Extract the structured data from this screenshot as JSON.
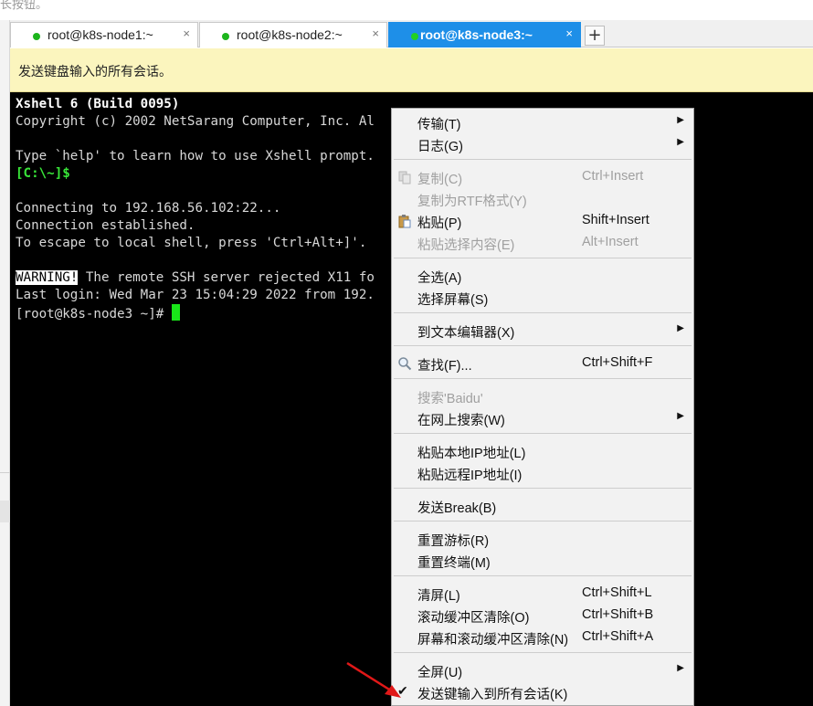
{
  "top_fragment": "长按钮。",
  "tabs": [
    {
      "label": "root@k8s-node1:~",
      "close": "×",
      "active": false
    },
    {
      "label": "root@k8s-node2:~",
      "close": "×",
      "active": false
    },
    {
      "label": "root@k8s-node3:~",
      "close": "×",
      "active": true
    }
  ],
  "add_tab": "+",
  "notice": "发送键盘输入的所有会话。",
  "terminal": {
    "banner_title": "Xshell 6 (Build 0095)",
    "copyright": "Copyright (c) 2002 NetSarang Computer, Inc. Al",
    "help": "Type `help' to learn how to use Xshell prompt.",
    "local_prompt": "[C:\\~]$",
    "connecting": "Connecting to 192.168.56.102:22...",
    "established": "Connection established.",
    "escape": "To escape to local shell, press 'Ctrl+Alt+]'.",
    "warning_tag": "WARNING!",
    "warning_rest": " The remote SSH server rejected X11 fo",
    "last_login": "Last login: Wed Mar 23 15:04:29 2022 from 192.",
    "prompt": "[root@k8s-node3 ~]# "
  },
  "menu": {
    "transfer": "传输(T)",
    "log": "日志(G)",
    "copy": "复制(C)",
    "copy_sc": "Ctrl+Insert",
    "copy_rtf": "复制为RTF格式(Y)",
    "paste": "粘贴(P)",
    "paste_sc": "Shift+Insert",
    "paste_sel": "粘贴选择内容(E)",
    "paste_sel_sc": "Alt+Insert",
    "select_all": "全选(A)",
    "select_screen": "选择屏幕(S)",
    "to_editor": "到文本编辑器(X)",
    "find": "查找(F)...",
    "find_sc": "Ctrl+Shift+F",
    "search_baidu": "搜索'Baidu'",
    "search_web": "在网上搜索(W)",
    "paste_local_ip": "粘贴本地IP地址(L)",
    "paste_remote_ip": "粘贴远程IP地址(I)",
    "send_break": "发送Break(B)",
    "reset_cursor": "重置游标(R)",
    "reset_terminal": "重置终端(M)",
    "clear_screen": "清屏(L)",
    "clear_screen_sc": "Ctrl+Shift+L",
    "clear_scroll": "滚动缓冲区清除(O)",
    "clear_scroll_sc": "Ctrl+Shift+B",
    "clear_both": "屏幕和滚动缓冲区清除(N)",
    "clear_both_sc": "Ctrl+Shift+A",
    "fullscreen": "全屏(U)",
    "send_all": "发送键输入到所有会话(K)",
    "check_mark": "✔",
    "submenu_arrow": "▶"
  },
  "colors": {
    "active_tab": "#1e8fe8",
    "session_dot": "#1cb51c",
    "notice_bg": "#fbf5be",
    "terminal_bg": "#000000",
    "cursor": "#19e619",
    "annotation_arrow": "#e01818"
  }
}
